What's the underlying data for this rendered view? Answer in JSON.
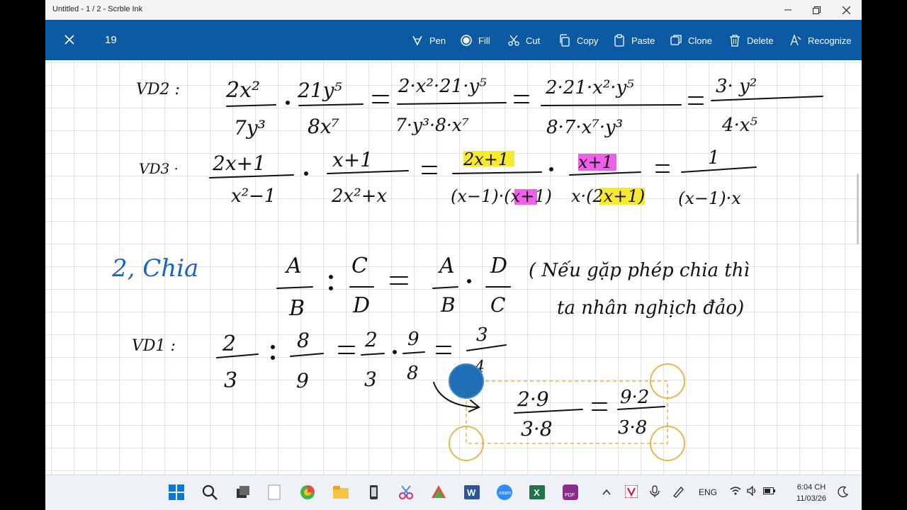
{
  "window": {
    "title": "Untitled - 1 / 2 - Scrble Ink"
  },
  "toolbar": {
    "page_number": "19",
    "tools": [
      {
        "label": "Pen",
        "icon": "pen-icon"
      },
      {
        "label": "Fill",
        "icon": "fill-icon"
      },
      {
        "label": "Cut",
        "icon": "scissors-icon"
      },
      {
        "label": "Copy",
        "icon": "copy-icon"
      },
      {
        "label": "Paste",
        "icon": "paste-icon"
      },
      {
        "label": "Clone",
        "icon": "clone-icon"
      },
      {
        "label": "Delete",
        "icon": "trash-icon"
      },
      {
        "label": "Recognize",
        "icon": "recognize-icon"
      }
    ]
  },
  "ink": {
    "vd2_label": "VD2 :",
    "vd3_label": "VD3 ·",
    "section_heading": "2, Chia",
    "rule_note_line1": "( Nếu gặp phép chia thì",
    "rule_note_line2": "ta nhân nghịch đảo)",
    "vd1_label": "VD1 :",
    "highlight_colors": {
      "yellow": "#f7e92f",
      "magenta": "#ee5fea"
    },
    "pen_colors": {
      "black": "#111111",
      "blue": "#1762c4"
    },
    "selection_color": "#e6b64a"
  },
  "taskbar": {
    "language": "ENG",
    "time": "6:04 CH",
    "date": "11/03/26",
    "apps": [
      "windows-start-icon",
      "search-icon",
      "task-view-icon",
      "file-icon",
      "browser-icon",
      "file-explorer-icon",
      "phone-link-icon",
      "snipping-tool-icon",
      "paint-icon",
      "word-icon",
      "zoom-icon",
      "excel-icon",
      "pdf-icon"
    ]
  }
}
